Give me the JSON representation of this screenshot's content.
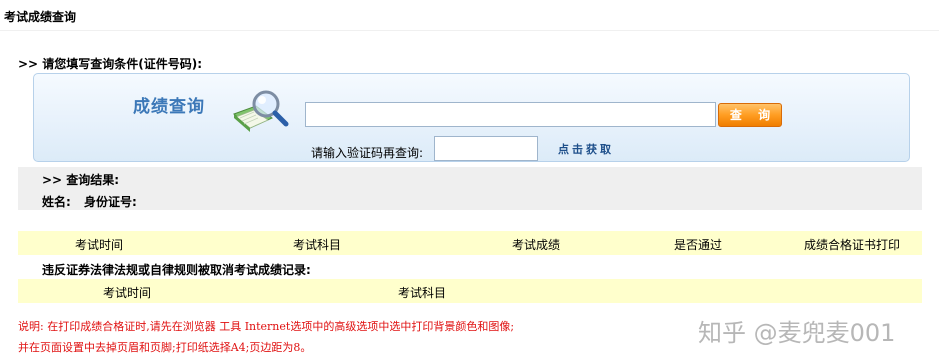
{
  "page_title": "考试成绩查询",
  "instruction": ">> 请您填写查询条件(证件号码):",
  "search_panel": {
    "heading": "成绩查询",
    "query_input": {
      "value": "",
      "placeholder": ""
    },
    "query_button_label": "查 询",
    "captcha_label": "请输入验证码再查询:",
    "captcha_input": {
      "value": "",
      "placeholder": ""
    },
    "captcha_link": "点击获取",
    "icon": "magnifier-book-icon"
  },
  "results": {
    "heading": ">> 查询结果:",
    "name_label": "姓名:",
    "id_label": "身份证号:"
  },
  "score_table": {
    "headers": [
      "考试时间",
      "考试科目",
      "考试成绩",
      "是否通过",
      "成绩合格证书打印"
    ]
  },
  "violation": {
    "heading": "违反证券法律法规或自律规则被取消考试成绩记录:",
    "headers": [
      "考试时间",
      "考试科目"
    ]
  },
  "notes": [
    "说明: 在打印成绩合格证时,请先在浏览器 工具 Internet选项中的高级选项中选中打印背景颜色和图像;",
    "并在页面设置中去掉页眉和页脚;打印纸选择A4;页边距为8。"
  ],
  "watermark": "知乎 @麦兜麦001",
  "colors": {
    "accent_blue": "#3c78b8",
    "button_orange": "#ff9d22",
    "table_header_bg": "#ffffcc",
    "note_red": "#e01010"
  }
}
